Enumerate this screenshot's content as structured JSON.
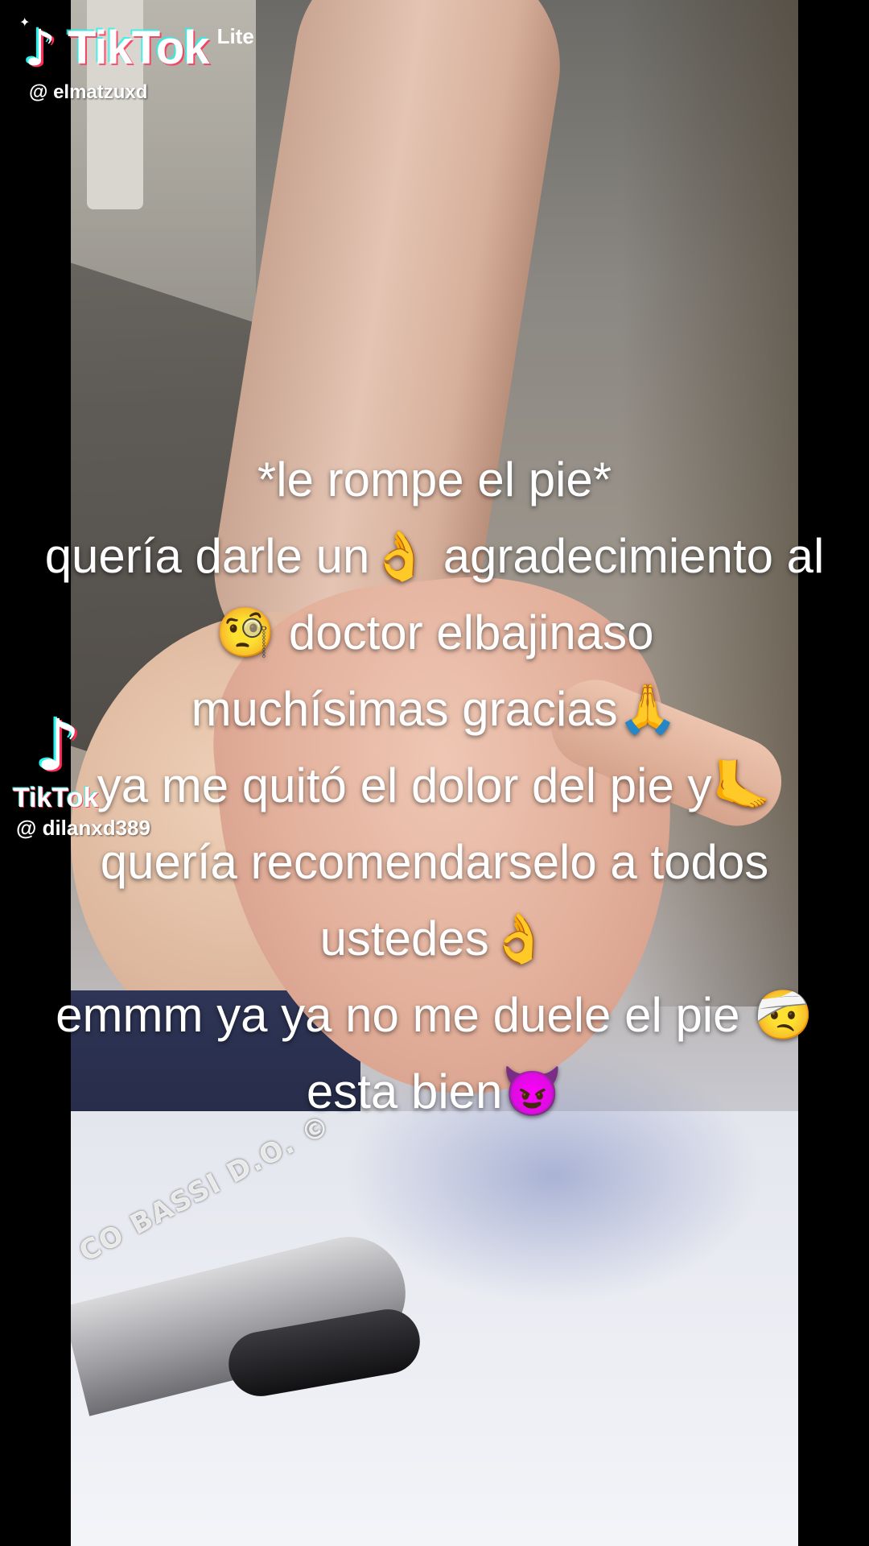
{
  "watermark_top": {
    "brand": "TikTok",
    "brand_suffix": "Lite",
    "username": "@ elmatzuxd"
  },
  "watermark_mid": {
    "brand": "TikTok",
    "username": "@ dilanxd389"
  },
  "video_watermark": "CO BASSI D.O. ©",
  "caption": {
    "lines": [
      "*le rompe el pie*",
      "quería darle un👌 agradecimiento al",
      "🧐 doctor elbajinaso",
      "muchísimas gracias🙏",
      "ya me quitó el dolor del pie y🦶",
      "quería recomendarselo a todos",
      "ustedes👌",
      "emmm ya ya no me duele el pie 🤕",
      "esta bien😈"
    ]
  },
  "icons": {
    "tiktok_logo": "tiktok-note-icon",
    "tiktok_logo_mid": "tiktok-note-icon"
  }
}
